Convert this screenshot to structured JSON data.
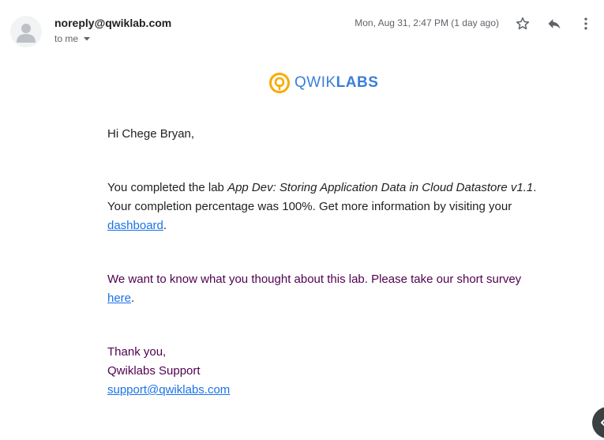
{
  "message": {
    "sender": "noreply@qwiklab.com",
    "recipient_label": "to me",
    "date": "Mon, Aug 31, 2:47 PM (1 day ago)"
  },
  "icons": {
    "avatar": "default-person-avatar",
    "recipient_caret": "caret-down-icon",
    "star": "star-outline-icon",
    "reply": "reply-icon",
    "more": "more-vertical-icon",
    "side_panel": "chevron-left-icon"
  },
  "logo": {
    "word_light": "QWIK",
    "word_bold": "LABS",
    "ring_color": "#f9ab00",
    "text_color": "#3a7fd8"
  },
  "body": {
    "greeting": "Hi Chege Bryan,",
    "completed_prefix": "You completed the lab ",
    "lab_name": "App Dev: Storing Application Data in Cloud Datastore v1.1",
    "completed_mid": ". Your completion percentage was 100%. Get more information by visiting your ",
    "dashboard_link": "dashboard",
    "period1": ".",
    "survey_text": "We want to know what you thought about this lab. Please take our short survey ",
    "survey_link": "here",
    "period2": ".",
    "thanks": "Thank you,",
    "signature": "Qwiklabs Support",
    "support_email": "support@qwiklabs.com"
  },
  "colors": {
    "link": "#1a73e8",
    "quoted_purple": "#500050",
    "body_text": "#222222",
    "meta_text": "#5f6368"
  }
}
